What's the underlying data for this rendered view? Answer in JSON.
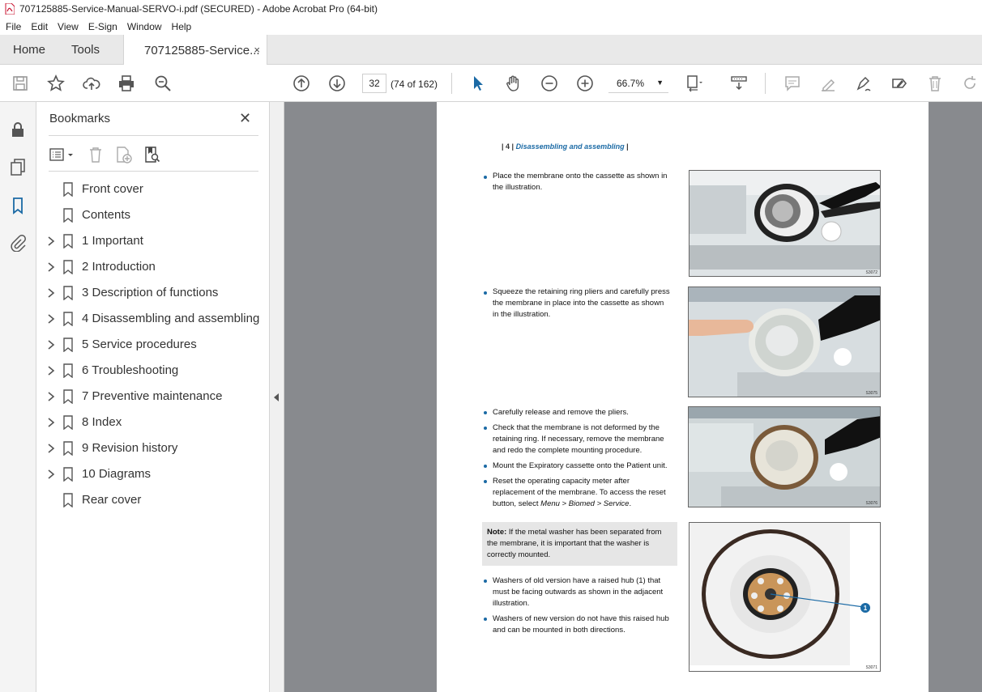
{
  "window": {
    "title": "707125885-Service-Manual-SERVO-i.pdf (SECURED) - Adobe Acrobat Pro (64-bit)"
  },
  "menu": [
    "File",
    "Edit",
    "View",
    "E-Sign",
    "Window",
    "Help"
  ],
  "tabs": {
    "home": "Home",
    "tools": "Tools",
    "doc": "707125885-Service...",
    "close": "×"
  },
  "toolbar": {
    "page_number": "32",
    "page_count": "(74 of 162)",
    "zoom": "66.7%"
  },
  "bookmarks": {
    "title": "Bookmarks",
    "items": [
      {
        "label": "Front cover",
        "expandable": false
      },
      {
        "label": "Contents",
        "expandable": false
      },
      {
        "label": "1 Important",
        "expandable": true
      },
      {
        "label": "2 Introduction",
        "expandable": true
      },
      {
        "label": "3 Description of functions",
        "expandable": true
      },
      {
        "label": "4 Disassembling and assembling",
        "expandable": true
      },
      {
        "label": "5 Service procedures",
        "expandable": true
      },
      {
        "label": "6 Troubleshooting",
        "expandable": true
      },
      {
        "label": "7 Preventive maintenance",
        "expandable": true
      },
      {
        "label": "8 Index",
        "expandable": true
      },
      {
        "label": "9 Revision history",
        "expandable": true
      },
      {
        "label": "10 Diagrams",
        "expandable": true
      },
      {
        "label": "Rear cover",
        "expandable": false
      }
    ]
  },
  "document": {
    "header_num": "| 4 |",
    "header_section": "Disassembling and assembling",
    "header_end": "|",
    "step1": [
      "Place the membrane onto the cassette as shown in",
      "the illustration."
    ],
    "step2": [
      "Squeeze the retaining ring pliers and carefully press",
      "the membrane in place into the cassette as shown",
      "in the illustration."
    ],
    "step3a": [
      "Carefully release and remove the pliers."
    ],
    "step3b": [
      "Check that the membrane is not deformed by the",
      "retaining ring. If necessary, remove the membrane",
      "and redo the complete mounting procedure."
    ],
    "step3c": [
      "Mount the Expiratory cassette onto the Patient unit."
    ],
    "step3d_1": "Reset the operating capacity meter after",
    "step3d_2": "replacement of the membrane. To access the reset",
    "step3d_3a": "button, select ",
    "step3d_menu": "Menu > Biomed > Service",
    "step3d_3b": ".",
    "note_label": "Note:",
    "note_1": " If the metal washer has been separated from",
    "note_2": "the membrane, it is important that the washer is",
    "note_3": "correctly mounted.",
    "step4a": [
      "Washers of old version have a raised hub (1) that",
      "must be facing outwards as shown in the adjacent",
      "illustration."
    ],
    "step4b": [
      "Washers of new version do not have this raised hub",
      "and can be mounted in both directions."
    ],
    "photo_codes": [
      "S3072",
      "S3075",
      "S3076",
      "S3071"
    ],
    "callout": "1"
  },
  "colors": {
    "accent": "#1b6aa5",
    "viewer_bg": "#888a8e",
    "tab_bg": "#e9e9e9"
  }
}
